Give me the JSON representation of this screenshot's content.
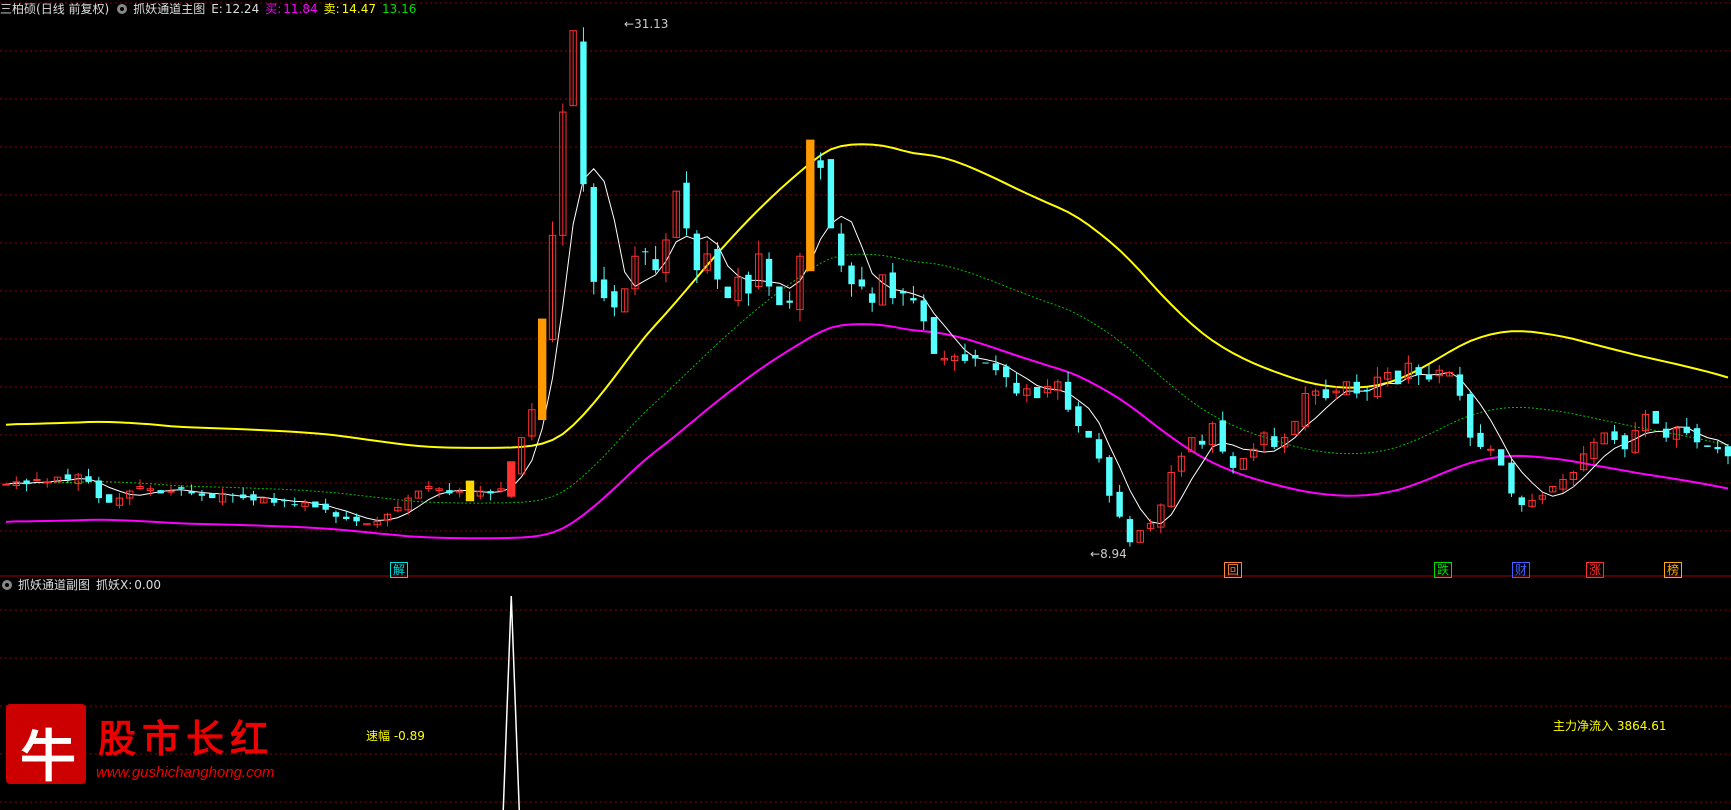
{
  "main_header": {
    "stock_name": "三柏硕",
    "period": "(日线 前复权)",
    "indicator": "抓妖通道主图",
    "e_label": "E:",
    "e_value": "12.24",
    "buy_label": "买:",
    "buy_value": "11.84",
    "sell_label": "卖:",
    "sell_value": "14.47",
    "extra_value": "13.16"
  },
  "sub_header": {
    "indicator": "抓妖通道副图",
    "x_label": "抓妖X:",
    "x_value": "0.00"
  },
  "price_labels": {
    "high": "31.13",
    "low": "8.94"
  },
  "signals": [
    {
      "name": "signal-jie",
      "text": "解",
      "color": "#00e0e0"
    },
    {
      "name": "signal-hui",
      "text": "回",
      "color": "#ff8040"
    },
    {
      "name": "signal-die",
      "text": "跌",
      "color": "#00e000"
    },
    {
      "name": "signal-cai",
      "text": "财",
      "color": "#4060ff"
    },
    {
      "name": "signal-zhang",
      "text": "涨",
      "color": "#ff3030"
    },
    {
      "name": "signal-bang",
      "text": "榜",
      "color": "#ffaa00"
    }
  ],
  "sub_labels": {
    "speed_label": "速幅",
    "speed_value": "-0.89",
    "flow_label": "主力净流入",
    "flow_value": "3864.61"
  },
  "watermark": {
    "logo_char": "牛",
    "title": "股市长红",
    "url": "www.gushichanghong.com"
  },
  "colors": {
    "up": "#ff3030",
    "down": "#54ffff",
    "upper_band": "#ffff00",
    "lower_band": "#ff00ff",
    "mid_band": "#00c000",
    "grid": "#8b0000",
    "signal_bar_orange": "#ff9900",
    "signal_bar_yellow": "#ffd700"
  },
  "chart_data": {
    "type": "candlestick",
    "price_range": [
      8.94,
      31.13
    ],
    "closes": [
      11.6,
      11.7,
      11.6,
      11.8,
      11.7,
      11.9,
      11.8,
      12.0,
      11.7,
      11.0,
      10.8,
      11.0,
      11.3,
      11.5,
      11.4,
      11.2,
      11.3,
      11.4,
      11.2,
      11.1,
      11.0,
      11.2,
      11.1,
      11.0,
      10.9,
      11.0,
      10.8,
      10.9,
      10.7,
      10.8,
      10.6,
      10.5,
      10.2,
      10.1,
      10.0,
      9.9,
      10.0,
      10.3,
      10.6,
      11.0,
      11.3,
      11.5,
      11.4,
      11.2,
      11.3,
      11.2,
      11.3,
      11.2,
      11.4,
      12.1,
      13.6,
      14.8,
      18.0,
      22.3,
      27.6,
      31.1,
      24.5,
      20.3,
      19.6,
      19.2,
      20.0,
      21.4,
      21.6,
      20.8,
      22.1,
      24.2,
      22.6,
      20.8,
      21.5,
      20.4,
      19.6,
      20.5,
      19.8,
      21.5,
      20.1,
      19.3,
      19.4,
      21.4,
      25.4,
      25.2,
      22.6,
      21.0,
      20.2,
      20.1,
      19.4,
      20.6,
      19.6,
      19.8,
      19.5,
      18.6,
      17.2,
      17.0,
      17.1,
      16.9,
      17.0,
      16.8,
      16.5,
      16.2,
      15.5,
      15.7,
      15.3,
      15.8,
      16.0,
      14.8,
      14.1,
      13.6,
      12.7,
      11.1,
      10.2,
      9.1,
      9.6,
      9.9,
      10.7,
      12.1,
      12.8,
      13.6,
      13.3,
      14.2,
      13.0,
      12.3,
      12.7,
      13.1,
      13.8,
      13.2,
      13.6,
      14.3,
      15.5,
      15.6,
      15.3,
      15.6,
      16.0,
      15.5,
      15.6,
      16.2,
      16.4,
      15.9,
      16.8,
      16.3,
      16.1,
      16.5,
      16.4,
      15.4,
      13.6,
      13.2,
      13.1,
      12.4,
      11.2,
      10.7,
      10.9,
      11.1,
      11.5,
      11.8,
      12.1,
      12.9,
      13.4,
      13.8,
      13.5,
      13.1,
      13.9,
      14.6,
      14.2,
      13.6,
      14.0,
      13.8,
      13.4,
      13.2,
      13.1,
      12.8
    ]
  }
}
